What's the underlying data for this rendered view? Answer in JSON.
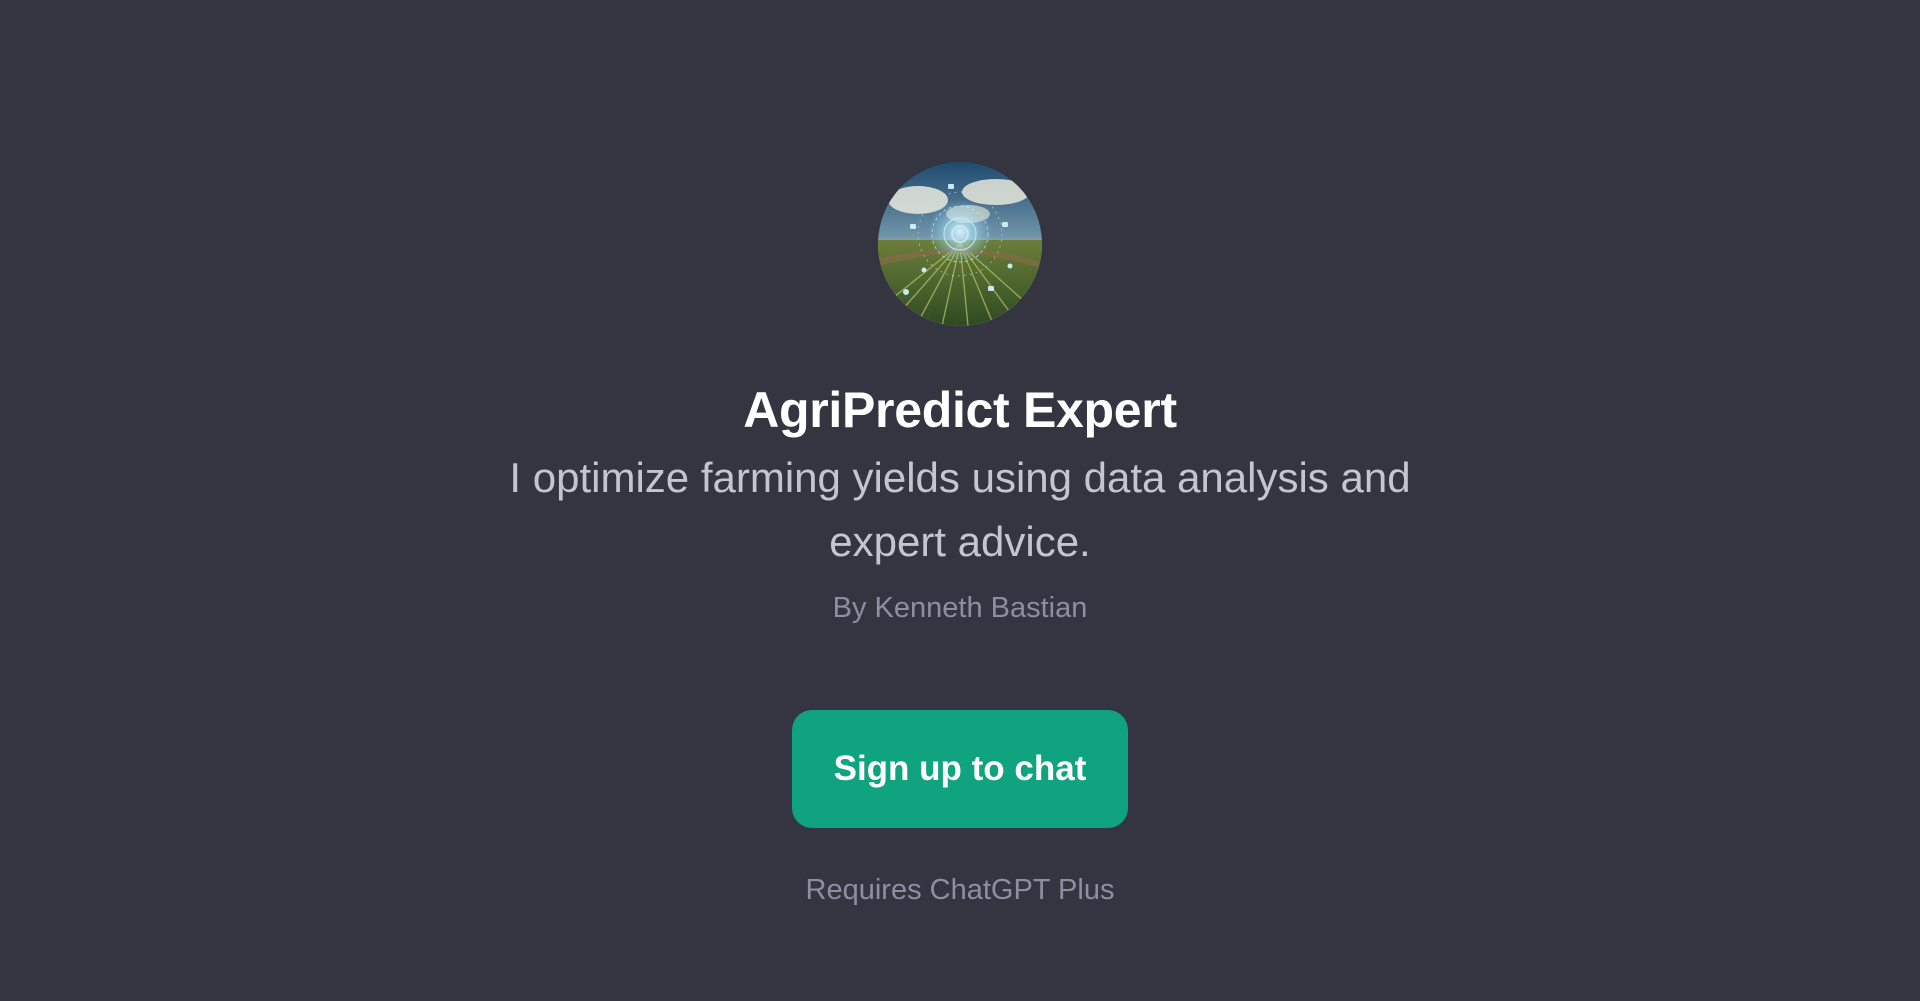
{
  "gpt": {
    "title": "AgriPredict Expert",
    "description": "I optimize farming yields using data analysis and expert advice.",
    "author": "By Kenneth Bastian",
    "avatar_icon": "agri-field-data-hud-image"
  },
  "cta": {
    "signup_label": "Sign up to chat",
    "requirement": "Requires ChatGPT Plus"
  },
  "colors": {
    "background": "#343541",
    "accent": "#10a37f",
    "title": "#ffffff",
    "description": "#c5c5d2",
    "muted": "#8e8ea0"
  }
}
